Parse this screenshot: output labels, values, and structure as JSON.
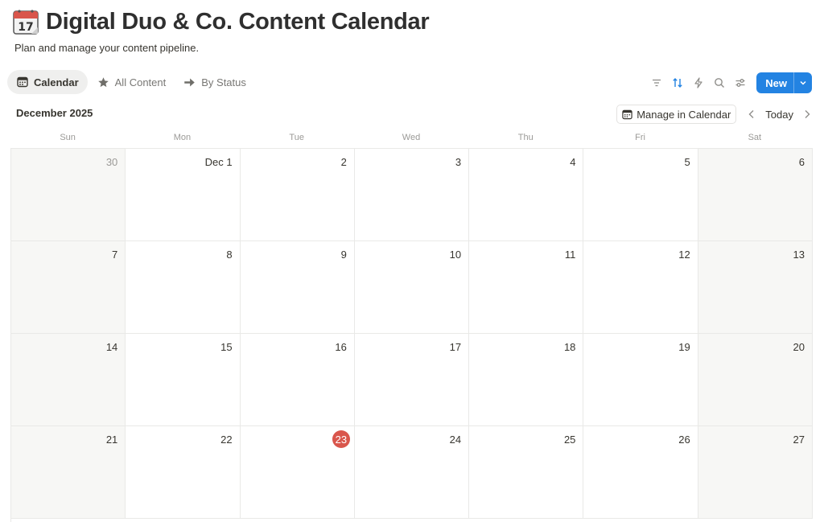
{
  "page": {
    "title": "Digital Duo & Co. Content Calendar",
    "subtitle": "Plan and manage your content pipeline.",
    "icon": "calendar-icon"
  },
  "tabs": [
    {
      "label": "Calendar",
      "icon": "calendar-view-icon",
      "active": true
    },
    {
      "label": "All Content",
      "icon": "star-icon",
      "active": false
    },
    {
      "label": "By Status",
      "icon": "arrow-right-icon",
      "active": false
    }
  ],
  "toolbar": {
    "new_label": "New",
    "icons": [
      "filter-icon",
      "sort-icon",
      "lightning-icon",
      "search-icon",
      "settings-sliders-icon"
    ],
    "accent": "#2383e2"
  },
  "calendar": {
    "month_label": "December 2025",
    "manage_label": "Manage in Calendar",
    "today_label": "Today",
    "weekdays": [
      "Sun",
      "Mon",
      "Tue",
      "Wed",
      "Thu",
      "Fri",
      "Sat"
    ],
    "today_color": "#d9564c",
    "weeks": [
      [
        {
          "label": "30",
          "muted": true
        },
        {
          "label": "Dec 1"
        },
        {
          "label": "2"
        },
        {
          "label": "3"
        },
        {
          "label": "4"
        },
        {
          "label": "5"
        },
        {
          "label": "6"
        }
      ],
      [
        {
          "label": "7"
        },
        {
          "label": "8"
        },
        {
          "label": "9"
        },
        {
          "label": "10"
        },
        {
          "label": "11"
        },
        {
          "label": "12"
        },
        {
          "label": "13"
        }
      ],
      [
        {
          "label": "14"
        },
        {
          "label": "15"
        },
        {
          "label": "16"
        },
        {
          "label": "17"
        },
        {
          "label": "18"
        },
        {
          "label": "19"
        },
        {
          "label": "20"
        }
      ],
      [
        {
          "label": "21"
        },
        {
          "label": "22"
        },
        {
          "label": "23",
          "today": true
        },
        {
          "label": "24"
        },
        {
          "label": "25"
        },
        {
          "label": "26"
        },
        {
          "label": "27"
        }
      ]
    ]
  }
}
